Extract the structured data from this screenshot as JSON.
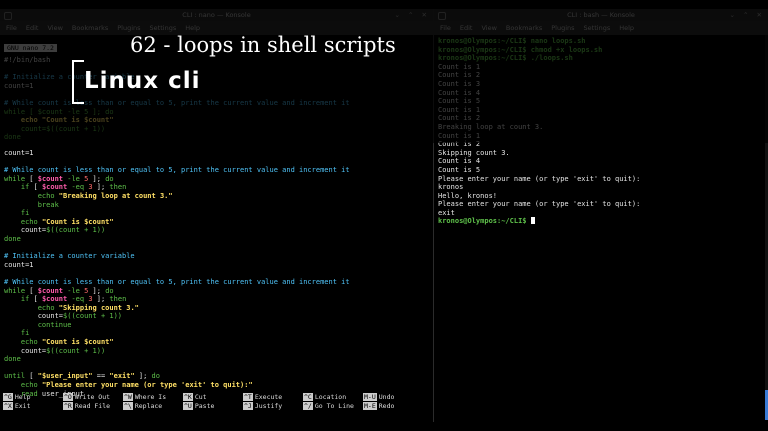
{
  "left_window": {
    "title": "CLI : nano — Konsole",
    "menu": [
      "File",
      "Edit",
      "View",
      "Bookmarks",
      "Plugins",
      "Settings",
      "Help"
    ],
    "nano_header": "GNU nano 7.2",
    "top_lines": [
      "#!/bin/bash",
      "",
      "# Initialize a counter variable",
      "count=1",
      "",
      "# While count is less than or equal to 5, print the current value and increment it",
      "while [ $count -le 5 ]; do",
      "    echo \"Count is $count\"",
      "    count=$((count + 1))",
      "done"
    ],
    "shortcuts_row1": [
      {
        "key": "^G",
        "label": "Help"
      },
      {
        "key": "^O",
        "label": "Write Out"
      },
      {
        "key": "^W",
        "label": "Where Is"
      },
      {
        "key": "^K",
        "label": "Cut"
      },
      {
        "key": "^T",
        "label": "Execute"
      },
      {
        "key": "^C",
        "label": "Location"
      },
      {
        "key": "M-U",
        "label": "Undo"
      }
    ],
    "shortcuts_row2": [
      {
        "key": "^X",
        "label": "Exit"
      },
      {
        "key": "^R",
        "label": "Read File"
      },
      {
        "key": "^\\",
        "label": "Replace"
      },
      {
        "key": "^U",
        "label": "Paste"
      },
      {
        "key": "^J",
        "label": "Justify"
      },
      {
        "key": "^/",
        "label": "Go To Line"
      },
      {
        "key": "M-E",
        "label": "Redo"
      }
    ]
  },
  "right_window": {
    "title": "CLI : bash — Konsole",
    "menu": [
      "File",
      "Edit",
      "View",
      "Bookmarks",
      "Plugins",
      "Settings",
      "Help"
    ],
    "dim_lines": [
      "kronos@Olympos:~/CLI$ nano loops.sh",
      "kronos@Olympos:~/CLI$ chmod +x loops.sh",
      "kronos@Olympos:~/CLI$ ./loops.sh",
      "Count is 1",
      "Count is 2",
      "Count is 3",
      "Count is 4",
      "Count is 5",
      "Count is 1",
      "Count is 2",
      "Breaking loop at count 3.",
      "Count is 1"
    ],
    "lines": [
      "Count is 2",
      "Skipping count 3.",
      "Count is 4",
      "Count is 5",
      "Please enter your name (or type 'exit' to quit):",
      "kronos",
      "Hello, kronos!",
      "Please enter your name (or type 'exit' to quit):",
      "exit"
    ],
    "prompt": "kronos@Olympos:~/CLI$"
  },
  "overlay": {
    "title": "62 - loops in shell scripts",
    "logo": "Linux cli"
  }
}
